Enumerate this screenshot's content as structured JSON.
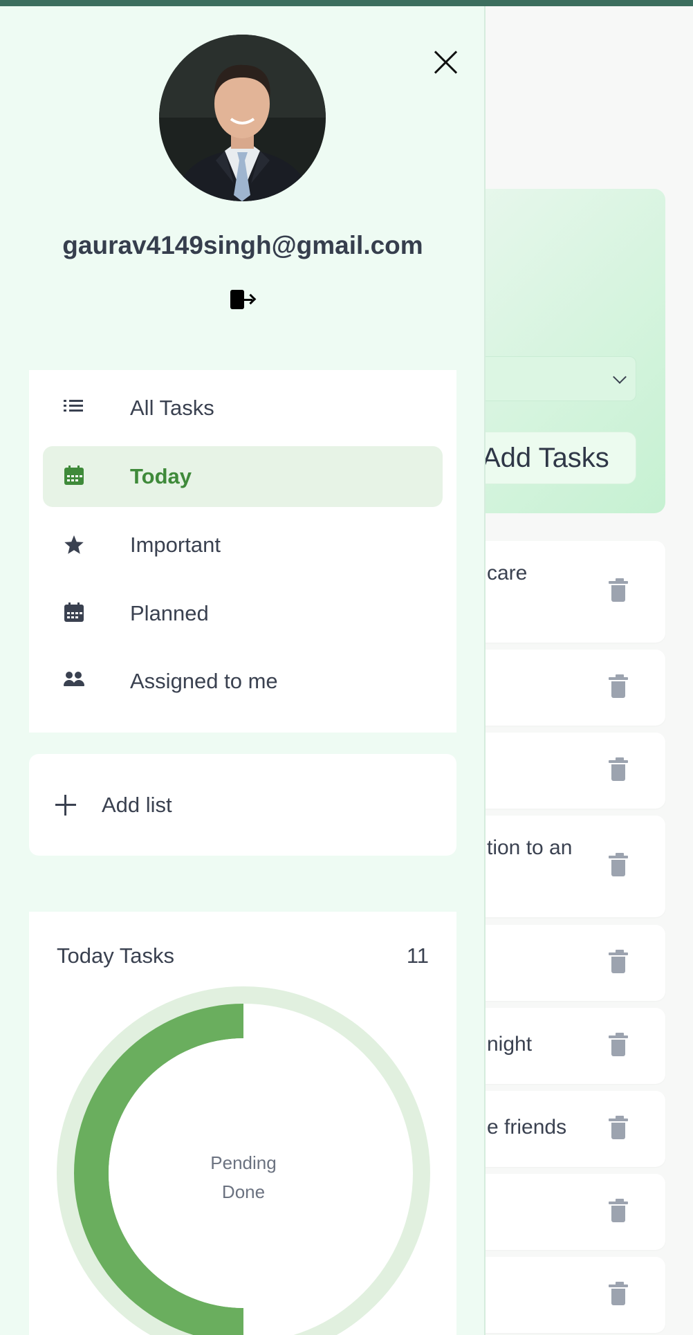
{
  "background": {
    "add_button_label": "Add Tasks",
    "tasks": [
      {
        "text": "care"
      },
      {
        "text": ""
      },
      {
        "text": ""
      },
      {
        "text": "tion to an"
      },
      {
        "text": ""
      },
      {
        "text": "night"
      },
      {
        "text": "e friends"
      },
      {
        "text": ""
      },
      {
        "text": ""
      }
    ]
  },
  "drawer": {
    "user_email": "gaurav4149singh@gmail.com",
    "nav_items": [
      {
        "label": "All Tasks",
        "icon": "list-icon",
        "active": false
      },
      {
        "label": "Today",
        "icon": "calendar-today-icon",
        "active": true
      },
      {
        "label": "Important",
        "icon": "star-icon",
        "active": false
      },
      {
        "label": "Planned",
        "icon": "calendar-icon",
        "active": false
      },
      {
        "label": "Assigned to me",
        "icon": "people-icon",
        "active": false
      }
    ],
    "add_list_label": "Add list",
    "stats": {
      "title": "Today Tasks",
      "count": "11",
      "legend_pending": "Pending",
      "legend_done": "Done"
    }
  },
  "colors": {
    "accent_green": "#6aae5e",
    "active_text": "#3f8a3a",
    "donut_track": "#e1f0df",
    "topbar": "#3c6e5e"
  },
  "chart_data": {
    "type": "pie",
    "title": "Today Tasks",
    "categories": [
      "Pending",
      "Done"
    ],
    "values": [
      50,
      50
    ]
  }
}
